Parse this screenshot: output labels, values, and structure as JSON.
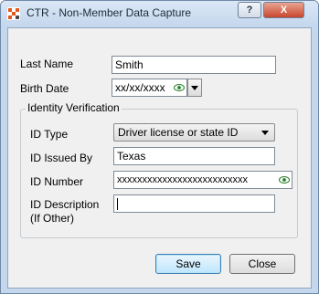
{
  "window": {
    "title": "CTR - Non-Member Data Capture",
    "help_glyph": "?",
    "close_glyph": "X"
  },
  "fields": {
    "last_name": {
      "label": "Last Name",
      "value": "Smith"
    },
    "birth_date": {
      "label": "Birth Date",
      "value": "xx/xx/xxxx"
    }
  },
  "identity": {
    "group_title": "Identity Verification",
    "id_type": {
      "label": "ID Type",
      "value": "Driver license or state ID"
    },
    "id_issued_by": {
      "label": "ID Issued By",
      "value": "Texas"
    },
    "id_number": {
      "label": "ID Number",
      "value": "xxxxxxxxxxxxxxxxxxxxxxxxxx"
    },
    "id_description": {
      "label_line1": "ID Description",
      "label_line2": "(If Other)",
      "value": ""
    }
  },
  "buttons": {
    "save": "Save",
    "close": "Close"
  },
  "colors": {
    "accent": "#3c7fb1",
    "title_bar": "#c5d8ee",
    "close_button": "#c9452c"
  }
}
